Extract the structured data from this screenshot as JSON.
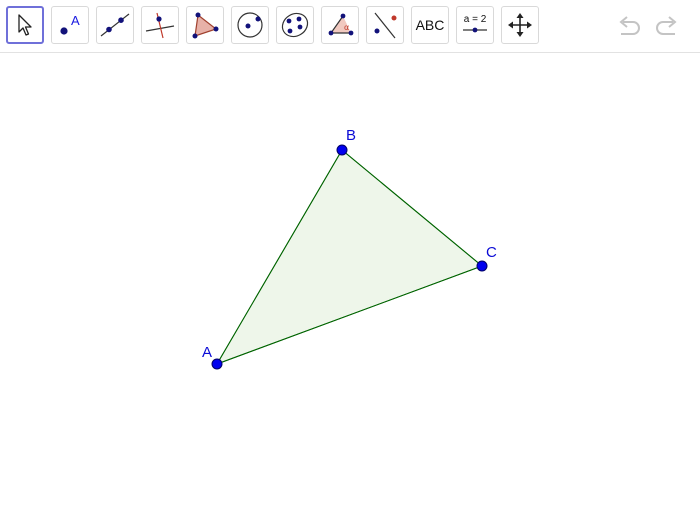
{
  "toolbar": {
    "tools": [
      {
        "name": "move",
        "active": true
      },
      {
        "name": "point",
        "icon_label": "A"
      },
      {
        "name": "line"
      },
      {
        "name": "perpendicular-line"
      },
      {
        "name": "polygon"
      },
      {
        "name": "circle-center-point"
      },
      {
        "name": "conic-five-points"
      },
      {
        "name": "angle",
        "icon_label": "α"
      },
      {
        "name": "reflect-about-line"
      },
      {
        "name": "text",
        "label": "ABC"
      },
      {
        "name": "slider",
        "label": "a = 2"
      },
      {
        "name": "move-graphics-view"
      }
    ],
    "undo_enabled": false,
    "redo_enabled": false
  },
  "colors": {
    "point_fill": "#0000ee",
    "label": "#0b0bd6",
    "polygon_stroke": "#006400",
    "polygon_fill": "#eef6ea",
    "active_border": "#6f70d9"
  },
  "construction": {
    "points": [
      {
        "id": "A",
        "label": "A"
      },
      {
        "id": "B",
        "label": "B"
      },
      {
        "id": "C",
        "label": "C"
      }
    ],
    "polygon": {
      "vertices": [
        "A",
        "B",
        "C"
      ]
    }
  }
}
